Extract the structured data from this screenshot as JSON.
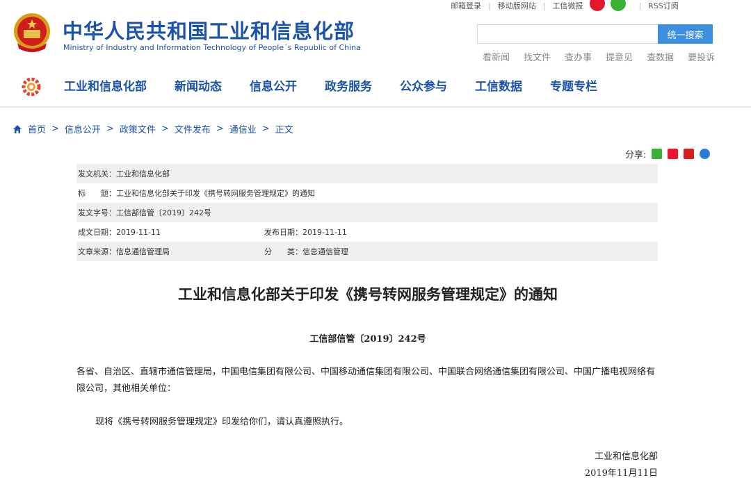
{
  "header": {
    "site_title": "中华人民共和国工业和信息化部",
    "site_subtitle": "Ministry of Industry and Information Technology of People´s Republic of China",
    "top_links": [
      "邮箱登录",
      "移动版网站",
      "工信微报"
    ],
    "rss": "RSS订阅",
    "search": {
      "value": "",
      "button": "统一搜索"
    },
    "quick_links": [
      "看新闻",
      "找文件",
      "查办事",
      "提意见",
      "查数据",
      "要投诉"
    ]
  },
  "nav": [
    "工业和信息化部",
    "新闻动态",
    "信息公开",
    "政务服务",
    "公众参与",
    "工信数据",
    "专题专栏"
  ],
  "breadcrumb": [
    "首页",
    "信息公开",
    "政策文件",
    "文件发布",
    "通信业",
    "正文"
  ],
  "share": {
    "label": "分享:"
  },
  "meta": {
    "issuer": "发文机关：工业和信息化部",
    "title": "标　　题：工业和信息化部关于印发《携号转网服务管理规定》的通知",
    "doc_no": "发文字号：工信部信管〔2019〕242号",
    "created": "成文日期：2019-11-11",
    "published": "发布日期：2019-11-11",
    "source": "文章来源：信息通信管理局",
    "category": "分　　类：信息通信管理"
  },
  "article": {
    "title": "工业和信息化部关于印发《携号转网服务管理规定》的通知",
    "doc_no": "工信部信管〔2019〕242号",
    "para1": "各省、自治区、直辖市通信管理局，中国电信集团有限公司、中国移动通信集团有限公司、中国联合网络通信集团有限公司、中国广播电视网络有限公司，其他相关单位：",
    "para2": "现将《携号转网服务管理规定》印发给你们，请认真遵照执行。",
    "signature_org": "工业和信息化部",
    "signature_date": "2019年11月11日"
  },
  "colors": {
    "brand_blue": "#1b53a8",
    "search_button": "#3d8fe0",
    "meta_row_grey": "#efefef"
  }
}
